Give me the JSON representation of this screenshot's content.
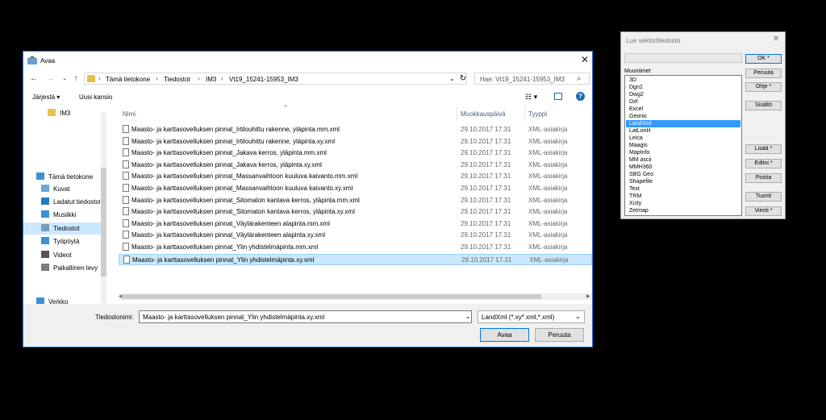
{
  "open_dialog": {
    "title": "Avaa",
    "breadcrumbs": [
      "Tämä tietokone",
      "Tiedostot",
      "IM3",
      "Vt19_15241-15953_IM3"
    ],
    "search_placeholder": "Hae: Vt19_15241-15953_IM3",
    "toolbar": {
      "organize": "Järjestä ▾",
      "new_folder": "Uusi kansio"
    },
    "nav_items": [
      {
        "label": "IM3",
        "icon": "folder-icon",
        "color": "#e8c14a"
      },
      {
        "label": "Tämä tietokone",
        "icon": "computer-icon",
        "color": "#3d8fd6"
      },
      {
        "label": "Kuvat",
        "icon": "pictures-icon",
        "color": "#6aa6d8"
      },
      {
        "label": "Ladatut tiedostot",
        "icon": "download-icon",
        "color": "#2a7ac2"
      },
      {
        "label": "Musiikki",
        "icon": "music-icon",
        "color": "#3d8fd6"
      },
      {
        "label": "Tiedostot",
        "icon": "documents-icon",
        "color": "#7a9bb8"
      },
      {
        "label": "Työpöytä",
        "icon": "desktop-icon",
        "color": "#3d8fd6"
      },
      {
        "label": "Videot",
        "icon": "video-icon",
        "color": "#555555"
      },
      {
        "label": "Paikallinen levy",
        "icon": "disk-icon",
        "color": "#7a7a7a"
      },
      {
        "label": "Verkko",
        "icon": "network-icon",
        "color": "#3d8fd6"
      }
    ],
    "columns": {
      "name": "Nimi",
      "modified": "Muokkauspäivä",
      "type": "Tyyppi"
    },
    "files": [
      {
        "name": "Maasto- ja karttasovelluksen pinnat_Irtilouhittu rakenne, yläpinta.mm.xml",
        "date": "29.10.2017 17.31",
        "type": "XML-asiakirja"
      },
      {
        "name": "Maasto- ja karttasovelluksen pinnat_Irtilouhittu rakenne, yläpinta.xy.xml",
        "date": "29.10.2017 17.31",
        "type": "XML-asiakirja"
      },
      {
        "name": "Maasto- ja karttasovelluksen pinnat_Jakava kerros, yläpinta.mm.xml",
        "date": "29.10.2017 17.31",
        "type": "XML-asiakirja"
      },
      {
        "name": "Maasto- ja karttasovelluksen pinnat_Jakava kerros, yläpinta.xy.xml",
        "date": "29.10.2017 17.31",
        "type": "XML-asiakirja"
      },
      {
        "name": "Maasto- ja karttasovelluksen pinnat_Massanvaihtoon kuuluva kaivanto.mm.xml",
        "date": "29.10.2017 17.31",
        "type": "XML-asiakirja"
      },
      {
        "name": "Maasto- ja karttasovelluksen pinnat_Massanvaihtoon kuuluva kaivanto.xy.xml",
        "date": "29.10.2017 17.31",
        "type": "XML-asiakirja"
      },
      {
        "name": "Maasto- ja karttasovelluksen pinnat_Sitomaton kantava kerros, yläpinta.mm.xml",
        "date": "29.10.2017 17.31",
        "type": "XML-asiakirja"
      },
      {
        "name": "Maasto- ja karttasovelluksen pinnat_Sitomaton kantava kerros, yläpinta.xy.xml",
        "date": "29.10.2017 17.31",
        "type": "XML-asiakirja"
      },
      {
        "name": "Maasto- ja karttasovelluksen pinnat_Väylärakenteen alapinta.mm.xml",
        "date": "29.10.2017 17.31",
        "type": "XML-asiakirja"
      },
      {
        "name": "Maasto- ja karttasovelluksen pinnat_Väylärakenteen alapinta.xy.xml",
        "date": "29.10.2017 17.31",
        "type": "XML-asiakirja"
      },
      {
        "name": "Maasto- ja karttasovelluksen pinnat_Ylin yhdistelmäpinta.mm.xml",
        "date": "29.10.2017 17.31",
        "type": "XML-asiakirja"
      },
      {
        "name": "Maasto- ja karttasovelluksen pinnat_Ylin yhdistelmäpinta.xy.xml",
        "date": "29.10.2017 17.31",
        "type": "XML-asiakirja"
      }
    ],
    "filename_label": "Tiedostonimi:",
    "filename_value": "Maasto- ja karttasovelluksen pinnat_Ylin yhdistelmäpinta.xy.xml",
    "filetype_value": "LandXml (*.xy*.xml,*.xml)",
    "open_button": "Avaa",
    "cancel_button": "Peruuta"
  },
  "vector_dialog": {
    "title": "Lue vektoritiedosto",
    "formats_label": "Muuntimet",
    "formats": [
      "3D",
      "Dgn2",
      "Dwg2",
      "Dxf",
      "Excel",
      "Geonic",
      "LandXml",
      "LatLonH",
      "Leica",
      "Maagis",
      "MapInfo",
      "MM ascii",
      "MMH360",
      "SBG Geo",
      "Shapefile",
      "Text",
      "TRM",
      "Xcity",
      "Zetmap"
    ],
    "selected_format": "LandXml",
    "buttons": {
      "ok": "OK *",
      "cancel": "Peruuta",
      "help": "Ohje *",
      "contents": "Sisältö",
      "add": "Lisää *",
      "edit": "Editoi *",
      "remove": "Poista",
      "import": "Tuonti",
      "export": "Vienti *"
    }
  }
}
